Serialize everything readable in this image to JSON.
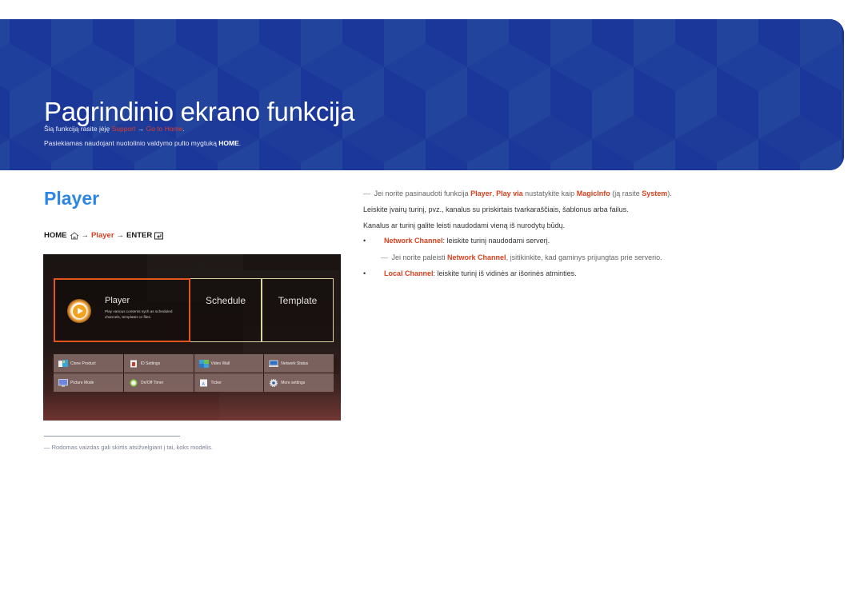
{
  "header": {
    "title": "Pagrindinio ekrano funkcija",
    "line1": {
      "prefix": "Šią funkciją rasite įėję ",
      "link1": "Support",
      "arrow": " → ",
      "link2": "Go to Home",
      "suffix": "."
    },
    "line2": {
      "prefix": "Pasiekiamas naudojant nuotolinio valdymo pulto mygtuką ",
      "key": "HOME",
      "suffix": "."
    },
    "colors": {
      "background": "#1e3b9a",
      "link": "#e23c25"
    }
  },
  "section": {
    "title": "Player",
    "path": {
      "home": "HOME",
      "arrow1": "→",
      "player": "Player",
      "arrow2": "→",
      "enter": "ENTER"
    }
  },
  "screen": {
    "tiles": {
      "player": {
        "title": "Player",
        "description": "Play various contents sych as scheduled channels, templates or files."
      },
      "schedule": "Schedule",
      "template": "Template"
    },
    "menu": [
      {
        "label": "Clone Product",
        "icon": "clone-product-icon"
      },
      {
        "label": "ID Settings",
        "icon": "id-settings-icon"
      },
      {
        "label": "Video Wall",
        "icon": "video-wall-icon"
      },
      {
        "label": "Network Status",
        "icon": "network-status-icon"
      },
      {
        "label": "Picture Mode",
        "icon": "picture-mode-icon"
      },
      {
        "label": "On/Off Timer",
        "icon": "on-off-timer-icon"
      },
      {
        "label": "Ticker",
        "icon": "ticker-icon"
      },
      {
        "label": "More settings",
        "icon": "more-settings-icon"
      }
    ],
    "colors": {
      "selected_border": "#e2551c",
      "tile_border": "#d9d3a6"
    }
  },
  "content": {
    "note1": {
      "dash": "―",
      "t1": " Jei norite pasinaudoti funkcija ",
      "k1": "Player",
      "t2": ", ",
      "k2": "Play via",
      "t3": " nustatykite kaip ",
      "k3": "MagicInfo",
      "t4": " (ją rasite ",
      "k4": "System",
      "t5": ")."
    },
    "para1": "Leiskite įvairų turinį, pvz., kanalus su priskirtais tvarkaraščiais, šablonus arba failus.",
    "para2": "Kanalus ar turinį galite leisti naudodami vieną iš nurodytų būdų.",
    "bullets": [
      {
        "bullet": "•",
        "key": "Network Channel",
        "text": ": leiskite turinį naudodami serverį."
      },
      {
        "bullet": "•",
        "key": "Local Channel",
        "text": ": leiskite turinį iš vidinės ar išorinės atminties."
      }
    ],
    "note2": {
      "dash": "―",
      "t1": " Jei norite paleisti ",
      "k1": "Network Channel",
      "t2": ", įsitikinkite, kad gaminys prijungtas prie serverio."
    },
    "accent": "#d8401e"
  },
  "footer": {
    "dash": "―",
    "note": "Rodomas vaizdas gali skirtis atsižvelgiant į tai, koks modelis."
  }
}
